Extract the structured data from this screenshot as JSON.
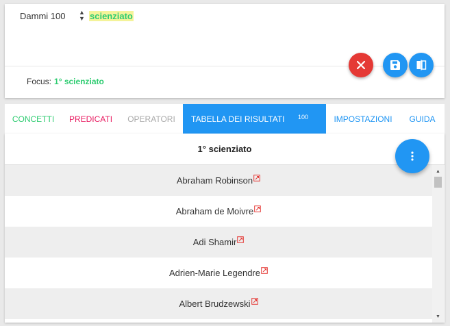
{
  "query": {
    "prefix": "Dammi 100",
    "concept": "scienziato",
    "focus_label": "Focus:",
    "focus_value": "1° scienziato"
  },
  "actions": {
    "cancel_icon": "close-icon",
    "save_icon": "floppy-disk-icon",
    "compare_icon": "compare-icon"
  },
  "tabs": [
    {
      "label": "CONCETTI"
    },
    {
      "label": "PREDICATI"
    },
    {
      "label": "OPERATORI"
    },
    {
      "label": "TABELLA DEI RISULTATI",
      "badge": "100",
      "active": true
    },
    {
      "label": "IMPOSTAZIONI"
    },
    {
      "label": "GUIDA"
    }
  ],
  "results": {
    "column_header": "1° scienziato",
    "rows": [
      "Abraham Robinson",
      "Abraham de Moivre",
      "Adi Shamir",
      "Adrien-Marie Legendre",
      "Albert Brudzewski"
    ]
  },
  "colors": {
    "primary": "#2196f3",
    "danger": "#e53935",
    "concept_green": "#2ecc71",
    "predicate_pink": "#e91e63",
    "highlight": "#f4f39a"
  }
}
